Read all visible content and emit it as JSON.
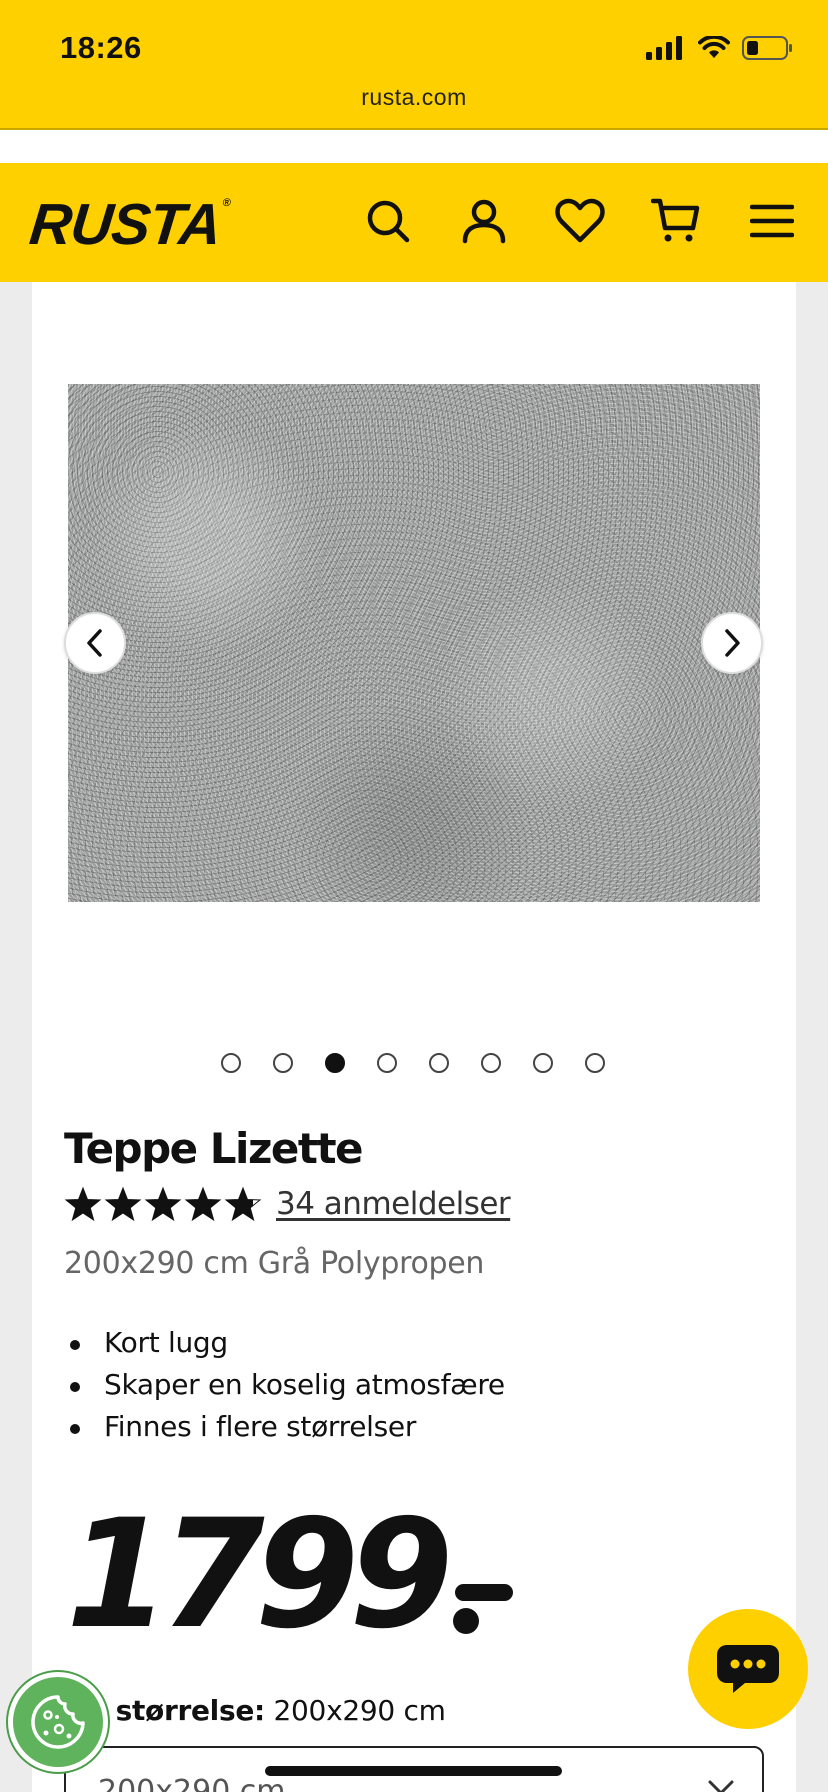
{
  "status_bar": {
    "time": "18:26",
    "url": "rusta.com"
  },
  "header": {
    "logo": "RUSTA",
    "logo_mark": "®",
    "icons": [
      "search-icon",
      "account-icon",
      "heart-icon",
      "cart-icon",
      "menu-icon"
    ],
    "colors": {
      "brand_yellow": "#ffd000",
      "text": "#111111"
    }
  },
  "gallery": {
    "image": "grey-shag-rug",
    "prev_icon": "chevron-left-icon",
    "next_icon": "chevron-right-icon",
    "slide_count": 8,
    "active_slide": 3
  },
  "product": {
    "title": "Teppe Lizette",
    "rating": 4.8,
    "rating_max": 5,
    "reviews_link": "34 anmeldelser",
    "subtitle": "200x290 cm Grå Polypropen",
    "features": [
      "Kort lugg",
      "Skaper en koselig atmosfære",
      "Finnes i flere størrelser"
    ],
    "price": "1799"
  },
  "size_selector": {
    "label_prefix": "lgt størrelse:",
    "label_value": " 200x290 cm",
    "selected": "200x290 cm"
  },
  "floating": {
    "cookie_icon": "cookie-icon",
    "chat_icon": "chat-bubble-icon",
    "cookie_color": "#5fb35d"
  }
}
